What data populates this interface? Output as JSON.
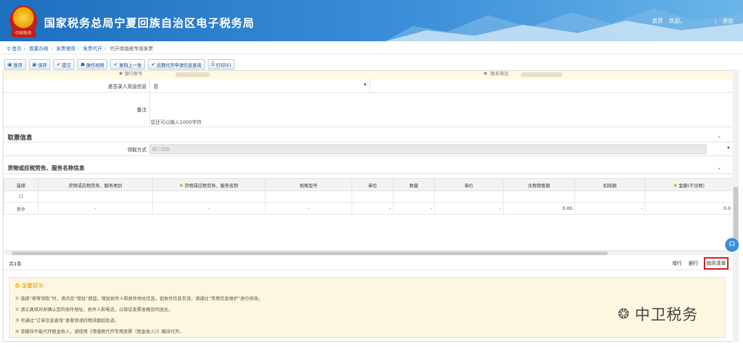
{
  "header": {
    "site_title": "国家税务总局宁夏回族自治区电子税务局",
    "emblem_label": "中国税务",
    "home": "首页",
    "welcome": "欢迎，",
    "divider": "|",
    "logout": "退出"
  },
  "breadcrumb": [
    "首页",
    "我要办税",
    "发票使用",
    "发票代开",
    "代开增值税专用发票"
  ],
  "toolbar": [
    "暂存",
    "保存",
    "提交",
    "操作视频",
    "复制上一张",
    "近期代开申请信息查询",
    "打印(E)"
  ],
  "form": {
    "bank_account_label": "银行账号",
    "contact_phone_label": "联系电话",
    "shipping_label": "是否录入货运信息",
    "shipping_value": "否",
    "remarks_label": "备注",
    "remarks_hint": "您还可以输入1000字符"
  },
  "pickup": {
    "section_title": "取票信息",
    "method_label": "领取方式",
    "method_value": "窗口领取"
  },
  "goods": {
    "section_title": "货物或应税劳务、服务名称信息",
    "columns": [
      "选择",
      "货物或应税劳务、服务类别",
      "货物或应税劳务、服务名称",
      "规格型号",
      "单位",
      "数量",
      "单价",
      "含税销售额",
      "扣除额",
      "金额(不含税)"
    ],
    "total_label": "合计",
    "total_cells": [
      "-",
      "-",
      "-",
      "-",
      "-",
      "-",
      "0.00",
      "-",
      "0.0"
    ],
    "record_count": "共1条",
    "add_row": "增行",
    "delete_row": "删行",
    "sales_list": "销货清单"
  },
  "tips": {
    "title": "温馨提示",
    "lines": [
      "① 选择“邮寄领取”时，请点击“增加”按钮，增加收件人和收件地址信息。如收件信息有误，请通过“常用信息维护”进行修改。",
      "② 请认真核对并确认您的收件地址、收件人和电话，以保证发票准确及时送达。",
      "③ 可通过“订单信息查询”查看快递的物流跟踪轨迹。",
      "④ 该模块不能代开租金收入，请使用《增值税代开专用发票（租金收入）》模块代开。"
    ]
  },
  "watermark": {
    "text": "中卫税务"
  },
  "colors": {
    "header_blue": "#1d6fbf",
    "highlight_red": "#d0191a",
    "tip_yellow": "#fdf7e0",
    "required_orange": "#e9a100"
  }
}
